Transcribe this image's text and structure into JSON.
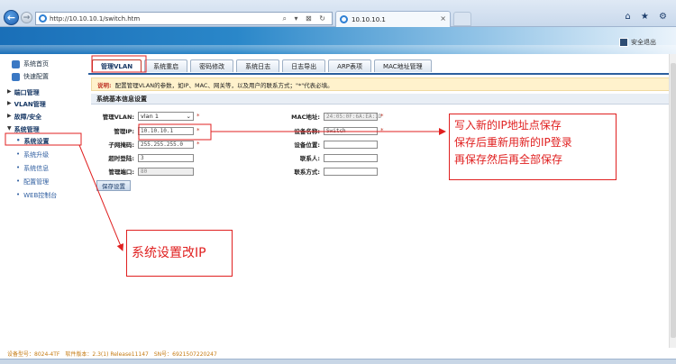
{
  "browser": {
    "url": "http://10.10.10.1/switch.htm",
    "url_tools": "⌕ ▾ ⊠ ↻",
    "tab_title": "10.10.10.1",
    "back_glyph": "←",
    "forward_glyph": "→",
    "close_glyph": "×",
    "window_glyphs": "⌂ ★ ⚙"
  },
  "header": {
    "logout_label": "安全退出"
  },
  "sidebar": {
    "home": "系统首页",
    "quick": "快速配置",
    "groups": [
      "端口管理",
      "VLAN管理",
      "故障/安全",
      "系统管理"
    ],
    "collapsed_glyph": "▶",
    "expanded_glyph": "▼",
    "bullet": "•",
    "subitems": [
      "系统设置",
      "系统升级",
      "系统信息",
      "配置管理",
      "WEB控制台"
    ]
  },
  "tabs": [
    "管理VLAN",
    "系统重启",
    "密码修改",
    "系统日志",
    "日志导出",
    "ARP表项",
    "MAC地址管理"
  ],
  "notice": {
    "label": "说明:",
    "text": "配置管理VLAN的参数，如IP、MAC、网关等，以及用户的联系方式；\"*\"代表必填。"
  },
  "panel_title": "系统基本信息设置",
  "form": {
    "mgmt_vlan_label": "管理VLAN:",
    "mgmt_vlan_value": "vlan 1",
    "mgmt_ip_label": "管理IP:",
    "mgmt_ip_value": "10.10.10.1",
    "subnet_label": "子网掩码:",
    "subnet_value": "255.255.255.0",
    "timeout_label": "超时登陆:",
    "timeout_value": "3",
    "mgmt_port_label": "管理端口:",
    "mgmt_port_value": "80",
    "mac_label": "MAC地址:",
    "mac_value": "24:05:0F:6A:EA:1D",
    "device_name_label": "设备名称:",
    "device_name_value": "Switch",
    "device_location_label": "设备位置:",
    "device_location_value": "",
    "contact_label": "联系人:",
    "contact_value": "",
    "contact_method_label": "联系方式:",
    "contact_method_value": "",
    "required_mark": "*",
    "save_label": "保存设置"
  },
  "annotations": {
    "right_note_lines": [
      "写入新的IP地址点保存",
      "保存后重新用新的IP登录",
      "再保存然后再全部保存"
    ],
    "left_note": "系统设置改IP"
  },
  "footer": {
    "model": "设备型号：8024-4TF",
    "version": "软件版本：2.3(1) Release11147",
    "sn": "SN号：6921507220247"
  },
  "colors": {
    "annotation": "#e02020",
    "header_blue": "#1a6fb8",
    "notice_bg": "#fff2cc",
    "footer_text": "#c57a12"
  }
}
